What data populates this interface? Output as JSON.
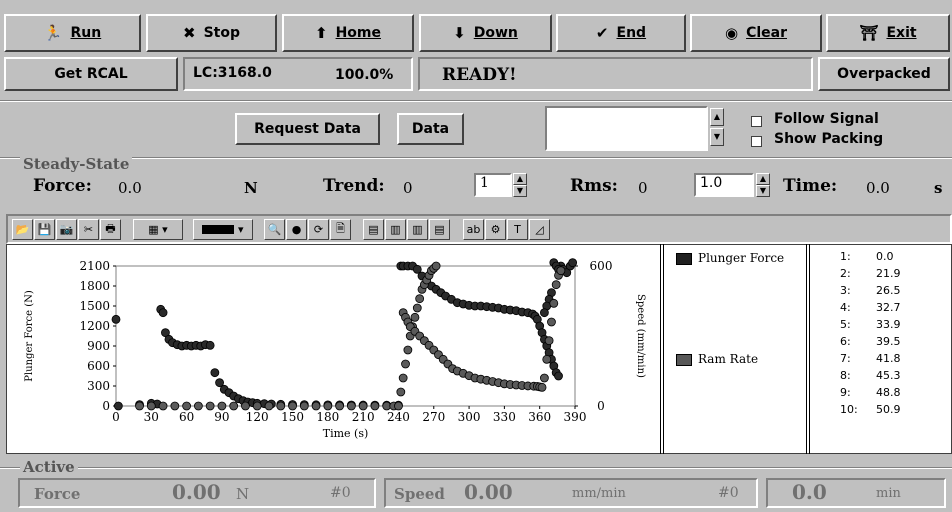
{
  "toolbar": {
    "run": {
      "label": "Run",
      "icon": "runner-icon"
    },
    "stop": {
      "label": "Stop",
      "icon": "x-icon"
    },
    "home": {
      "label": "Home",
      "icon": "arrow-up-icon"
    },
    "down": {
      "label": "Down",
      "icon": "arrow-down-icon"
    },
    "end": {
      "label": "End",
      "icon": "check-icon"
    },
    "clear": {
      "label": "Clear",
      "icon": "target-icon"
    },
    "exit": {
      "label": "Exit",
      "icon": "exit-icon"
    }
  },
  "status": {
    "rcal_button": "Get RCAL",
    "lc": "LC:3168.0",
    "percent": "100.0%",
    "state": "READY!",
    "overpacked_button": "Overpacked"
  },
  "request": {
    "request_button": "Request Data",
    "data_button": "Data",
    "follow_signal": "Follow Signal",
    "show_packing": "Show Packing"
  },
  "steady": {
    "section": "Steady-State",
    "force_label": "Force:",
    "force_value": "0.0",
    "force_unit": "N",
    "trend_label": "Trend:",
    "trend_value": "0",
    "trend_spin": "1",
    "rms_label": "Rms:",
    "rms_value": "0",
    "rms_spin": "1.0",
    "time_label": "Time:",
    "time_value": "0.0",
    "time_unit": "s"
  },
  "legend": {
    "items": [
      {
        "label": "Plunger Force",
        "color": "#202020"
      },
      {
        "label": "Ram Rate",
        "color": "#585858"
      }
    ],
    "list": [
      {
        "n": "1:",
        "v": "0.0"
      },
      {
        "n": "2:",
        "v": "21.9"
      },
      {
        "n": "3:",
        "v": "26.5"
      },
      {
        "n": "4:",
        "v": "32.7"
      },
      {
        "n": "5:",
        "v": "33.9"
      },
      {
        "n": "6:",
        "v": "39.5"
      },
      {
        "n": "7:",
        "v": "41.8"
      },
      {
        "n": "8:",
        "v": "45.3"
      },
      {
        "n": "9:",
        "v": "48.8"
      },
      {
        "n": "10:",
        "v": "50.9"
      }
    ]
  },
  "active": {
    "section": "Active",
    "force_label": "Force",
    "force_value": "0.00",
    "force_unit": "N",
    "force_index": "#0",
    "speed_label": "Speed",
    "speed_value": "0.00",
    "speed_unit": "mm/min",
    "speed_index": "#0",
    "third_value": "0.0",
    "third_unit": "min"
  },
  "chart_data": {
    "type": "scatter",
    "xlabel": "Time (s)",
    "ylabel": "Plunger Force (N)",
    "y2label": "Speed (mm/min)",
    "xlim": [
      0,
      390
    ],
    "ylim": [
      0,
      2100
    ],
    "y2lim": [
      0,
      600
    ],
    "x_ticks": [
      0,
      30,
      60,
      90,
      120,
      150,
      180,
      210,
      240,
      270,
      300,
      330,
      360,
      390
    ],
    "y_ticks": [
      0,
      300,
      600,
      900,
      1200,
      1500,
      1800,
      2100
    ],
    "y2_ticks": [
      0,
      600
    ],
    "grid": false,
    "series": [
      {
        "name": "Plunger Force",
        "axis": "left",
        "color": "#2a2a2a",
        "points": [
          [
            0,
            1300
          ],
          [
            2,
            0
          ],
          [
            20,
            20
          ],
          [
            30,
            40
          ],
          [
            35,
            30
          ],
          [
            38,
            1450
          ],
          [
            40,
            1400
          ],
          [
            42,
            1100
          ],
          [
            45,
            1000
          ],
          [
            48,
            950
          ],
          [
            52,
            920
          ],
          [
            56,
            900
          ],
          [
            60,
            910
          ],
          [
            64,
            900
          ],
          [
            68,
            910
          ],
          [
            72,
            900
          ],
          [
            76,
            920
          ],
          [
            80,
            910
          ],
          [
            84,
            500
          ],
          [
            88,
            350
          ],
          [
            92,
            250
          ],
          [
            96,
            200
          ],
          [
            100,
            150
          ],
          [
            104,
            110
          ],
          [
            108,
            80
          ],
          [
            112,
            60
          ],
          [
            116,
            50
          ],
          [
            120,
            40
          ],
          [
            126,
            35
          ],
          [
            132,
            30
          ],
          [
            140,
            25
          ],
          [
            150,
            22
          ],
          [
            160,
            20
          ],
          [
            170,
            18
          ],
          [
            180,
            17
          ],
          [
            190,
            16
          ],
          [
            200,
            15
          ],
          [
            210,
            14
          ],
          [
            220,
            13
          ],
          [
            230,
            12
          ],
          [
            240,
            12
          ],
          [
            242,
            2100
          ],
          [
            244,
            2100
          ],
          [
            248,
            2100
          ],
          [
            252,
            2100
          ],
          [
            256,
            2050
          ],
          [
            260,
            1950
          ],
          [
            264,
            1850
          ],
          [
            268,
            1800
          ],
          [
            272,
            1750
          ],
          [
            276,
            1700
          ],
          [
            280,
            1650
          ],
          [
            285,
            1600
          ],
          [
            290,
            1550
          ],
          [
            295,
            1530
          ],
          [
            300,
            1510
          ],
          [
            305,
            1500
          ],
          [
            310,
            1500
          ],
          [
            315,
            1490
          ],
          [
            320,
            1480
          ],
          [
            325,
            1470
          ],
          [
            330,
            1450
          ],
          [
            335,
            1440
          ],
          [
            340,
            1430
          ],
          [
            345,
            1410
          ],
          [
            350,
            1400
          ],
          [
            354,
            1380
          ],
          [
            356,
            1350
          ],
          [
            358,
            1300
          ],
          [
            360,
            1200
          ],
          [
            362,
            1100
          ],
          [
            364,
            1000
          ],
          [
            366,
            900
          ],
          [
            368,
            800
          ],
          [
            370,
            700
          ],
          [
            372,
            600
          ],
          [
            374,
            500
          ],
          [
            376,
            450
          ],
          [
            378,
            2100
          ],
          [
            380,
            2050
          ],
          [
            383,
            2000
          ],
          [
            386,
            2100
          ],
          [
            388,
            2150
          ],
          [
            372,
            2150
          ],
          [
            374,
            2100
          ],
          [
            376,
            2050
          ],
          [
            370,
            1700
          ],
          [
            368,
            1600
          ],
          [
            366,
            1500
          ],
          [
            364,
            1400
          ]
        ]
      },
      {
        "name": "Ram Rate",
        "axis": "right",
        "color": "#5a5a5a",
        "points": [
          [
            20,
            0
          ],
          [
            30,
            0
          ],
          [
            40,
            0
          ],
          [
            50,
            0
          ],
          [
            60,
            0
          ],
          [
            70,
            0
          ],
          [
            80,
            0
          ],
          [
            90,
            0
          ],
          [
            100,
            0
          ],
          [
            110,
            0
          ],
          [
            120,
            0
          ],
          [
            130,
            0
          ],
          [
            140,
            0
          ],
          [
            150,
            0
          ],
          [
            160,
            0
          ],
          [
            170,
            0
          ],
          [
            180,
            0
          ],
          [
            190,
            0
          ],
          [
            200,
            0
          ],
          [
            210,
            0
          ],
          [
            220,
            0
          ],
          [
            230,
            0
          ],
          [
            236,
            0
          ],
          [
            240,
            0
          ],
          [
            242,
            60
          ],
          [
            244,
            120
          ],
          [
            246,
            180
          ],
          [
            248,
            240
          ],
          [
            250,
            300
          ],
          [
            252,
            340
          ],
          [
            254,
            380
          ],
          [
            256,
            420
          ],
          [
            258,
            460
          ],
          [
            260,
            500
          ],
          [
            262,
            520
          ],
          [
            264,
            540
          ],
          [
            266,
            560
          ],
          [
            268,
            580
          ],
          [
            270,
            590
          ],
          [
            272,
            600
          ],
          [
            244,
            400
          ],
          [
            246,
            380
          ],
          [
            248,
            360
          ],
          [
            250,
            340
          ],
          [
            254,
            320
          ],
          [
            258,
            300
          ],
          [
            262,
            280
          ],
          [
            266,
            260
          ],
          [
            270,
            240
          ],
          [
            274,
            220
          ],
          [
            278,
            200
          ],
          [
            282,
            180
          ],
          [
            286,
            160
          ],
          [
            290,
            150
          ],
          [
            295,
            140
          ],
          [
            300,
            130
          ],
          [
            305,
            120
          ],
          [
            310,
            115
          ],
          [
            315,
            110
          ],
          [
            320,
            105
          ],
          [
            325,
            100
          ],
          [
            330,
            95
          ],
          [
            335,
            92
          ],
          [
            340,
            90
          ],
          [
            345,
            88
          ],
          [
            350,
            86
          ],
          [
            355,
            85
          ],
          [
            358,
            84
          ],
          [
            360,
            82
          ],
          [
            362,
            80
          ],
          [
            364,
            120
          ],
          [
            366,
            200
          ],
          [
            368,
            280
          ],
          [
            370,
            360
          ],
          [
            372,
            440
          ],
          [
            374,
            520
          ],
          [
            376,
            560
          ],
          [
            378,
            580
          ]
        ]
      }
    ]
  }
}
